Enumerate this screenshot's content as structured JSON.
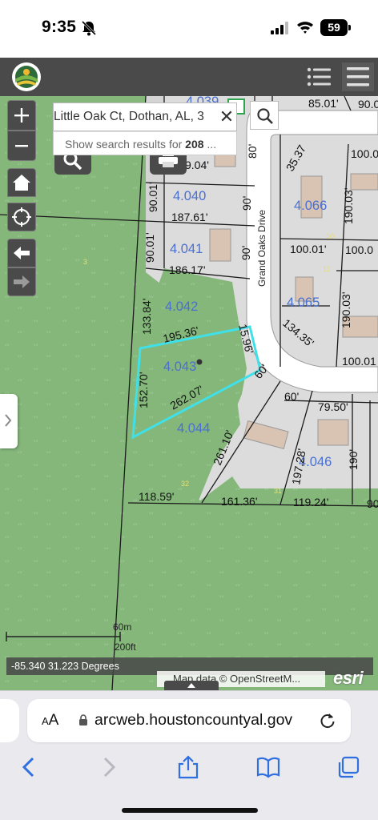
{
  "status_bar": {
    "time": "9:35",
    "battery": "59"
  },
  "search": {
    "value": "Little Oak Ct, Dothan, AL, 3",
    "clear_glyph": "✕",
    "suggestion_prefix": "Show search results for ",
    "suggestion_query": "208",
    "suggestion_suffix": " ..."
  },
  "map": {
    "parcels": [
      "4.040",
      "4.041",
      "4.042",
      "4.043",
      "4.044",
      "4.066",
      "4.065",
      "4.046",
      "4.039"
    ],
    "lot_numbers": [
      "3",
      "10",
      "11",
      "32",
      "31"
    ],
    "dimensions": [
      "85.01'",
      "90.0",
      "9.04'",
      "80'",
      "35.37",
      "100.0",
      "90.01'",
      "187.61'",
      "90'",
      "190.03'",
      "90.01'",
      "186.17'",
      "90'",
      "100.01'",
      "100.0",
      "133.84'",
      "195.36'",
      "15.96'",
      "134.35'",
      "190.03'",
      "100.01",
      "152.70'",
      "262.07'",
      "60'",
      "60'",
      "79.50'",
      "261.10'",
      "197.28'",
      "190'",
      "118.59'",
      "161.36'",
      "119.24'",
      "90"
    ],
    "street": "Grand Oaks Drive",
    "scale_metric": "60m",
    "scale_imperial": "200ft",
    "coordinates": "-85.340 31.223 Degrees",
    "attribution": "Map data © OpenStreetM...",
    "esri": "esri",
    "colors": {
      "grass": "#84b77a",
      "road": "#ffffff",
      "parcel_line": "#1a1a1a",
      "selection": "#3fe0e8",
      "label": "#4a6fd1"
    }
  },
  "browser": {
    "aa": "AA",
    "url": "arcweb.houstoncountyal.gov"
  },
  "icons": [
    "bell-slash-icon",
    "signal-icon",
    "wifi-icon",
    "battery-icon",
    "county-logo-icon",
    "layer-list-icon",
    "menu-icon",
    "zoom-in-icon",
    "zoom-out-icon",
    "home-icon",
    "locate-icon",
    "back-arrow-icon",
    "forward-arrow-icon",
    "search-icon",
    "print-icon",
    "lock-icon",
    "reload-icon",
    "chevron-left-icon",
    "chevron-right-icon",
    "share-icon",
    "bookmarks-icon",
    "tabs-icon"
  ]
}
